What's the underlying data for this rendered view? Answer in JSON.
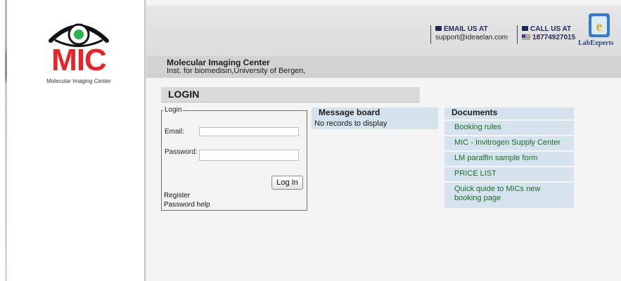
{
  "logo": {
    "text": "MIC",
    "subtitle": "Molecular Imaging Center"
  },
  "header": {
    "email_label": "EMAIL US AT",
    "email_value": "support@ideaelan.com",
    "phone_label": "CALL US AT",
    "phone_value": "18774927015",
    "partner_name": "LabExperts"
  },
  "org": {
    "name": "Molecular Imaging Center",
    "institute": "Inst. for biomedisin,University of Bergen,"
  },
  "login": {
    "title": "LOGIN",
    "legend": "Login",
    "email_label": "Email:",
    "email_value": "",
    "password_label": "Password:",
    "password_value": "",
    "button_label": "Log In",
    "register_link": "Register",
    "password_help_link": "Password help"
  },
  "message_board": {
    "title": "Message board",
    "empty_text": "No records to display"
  },
  "documents": {
    "title": "Documents",
    "items": [
      {
        "label": "Booking rules"
      },
      {
        "label": "MIC - Invitrogen Supply Center"
      },
      {
        "label": "LM paraffin sample form"
      },
      {
        "label": "PRICE LIST"
      },
      {
        "label": "Quick quide to MICs new booking page"
      }
    ]
  },
  "colors": {
    "brand_red": "#e3262a",
    "link_green": "#1e6b2b",
    "panel_blue": "#d5e3ee",
    "header_navy": "#1d2c57"
  },
  "icons": [
    "eye-logo-icon",
    "mail-icon",
    "us-flag-icon",
    "labexperts-logo-icon"
  ]
}
